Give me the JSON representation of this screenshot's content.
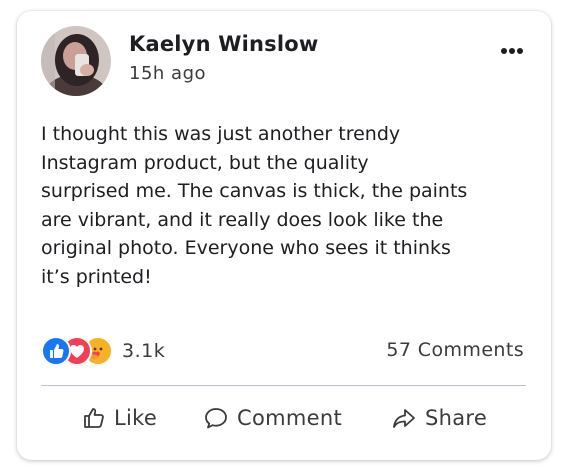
{
  "post": {
    "author": "Kaelyn Winslow",
    "time": "15h ago",
    "body": "I thought this was just another trendy\nInstagram product, but the quality\nsurprised me. The canvas is thick, the paints\nare vibrant, and it really does look like the\noriginal photo. Everyone who sees it thinks\nit’s printed!",
    "reactions": {
      "icons": [
        "like-icon",
        "love-icon",
        "care-icon"
      ],
      "count": "3.1k"
    },
    "comments_count": "57 Comments",
    "actions": {
      "like": "Like",
      "comment": "Comment",
      "share": "Share"
    }
  },
  "colors": {
    "like_blue": "#1877f2",
    "love_red": "#f33e58",
    "care_yellow": "#f7b125",
    "text": "#1c1e21",
    "secondary_text": "#3a3b3c",
    "divider": "#b9c4cc"
  }
}
